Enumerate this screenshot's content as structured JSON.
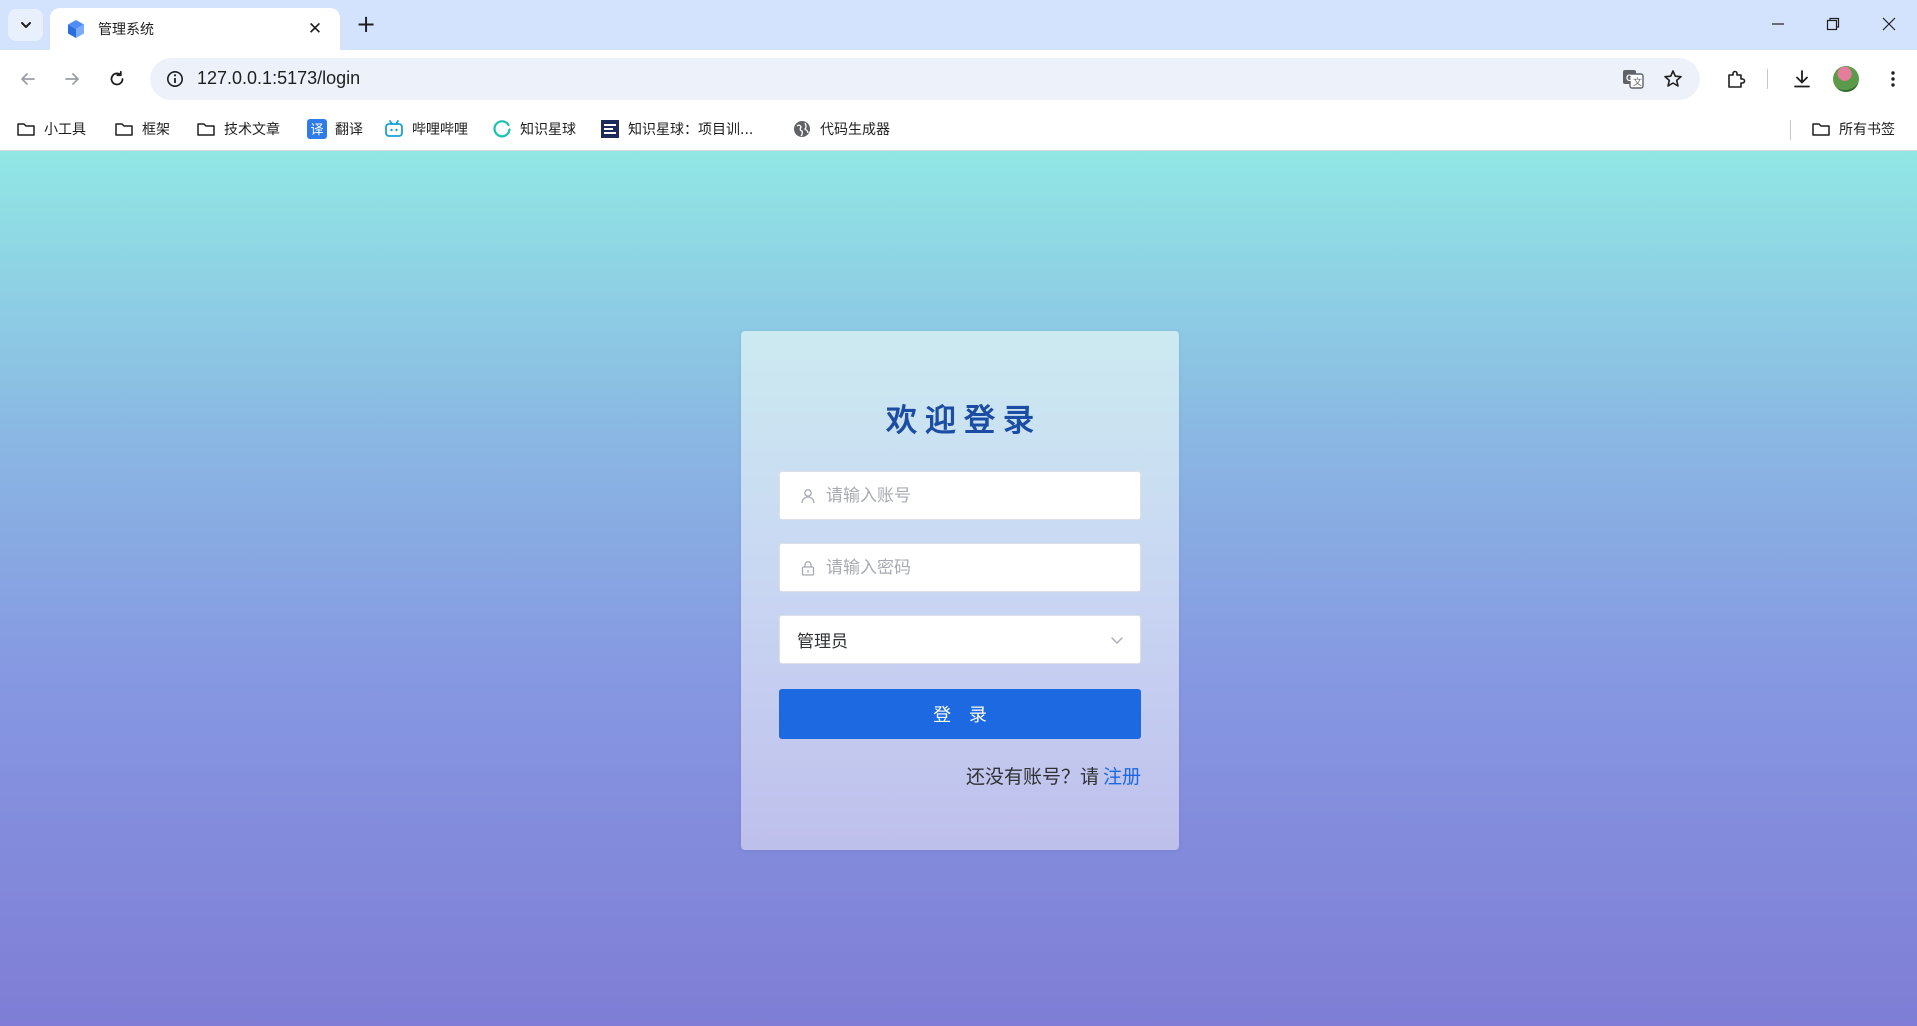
{
  "browser": {
    "tab": {
      "title": "管理系统"
    },
    "new_tab_label": "+",
    "url": "127.0.0.1:5173/login",
    "bookmarks": [
      {
        "label": "小工具",
        "icon": "folder-icon"
      },
      {
        "label": "框架",
        "icon": "folder-icon"
      },
      {
        "label": "技术文章",
        "icon": "folder-icon"
      },
      {
        "label": "翻译",
        "icon": "translate-icon"
      },
      {
        "label": "哔哩哔哩",
        "icon": "bilibili-icon"
      },
      {
        "label": "知识星球",
        "icon": "zsxq-icon"
      },
      {
        "label": "知识星球：项目训...",
        "icon": "zsxq-project-icon"
      },
      {
        "label": "代码生成器",
        "icon": "globe-icon"
      }
    ],
    "all_bookmarks": "所有书签"
  },
  "login": {
    "title": "欢迎登录",
    "username_placeholder": "请输入账号",
    "password_placeholder": "请输入密码",
    "role_selected": "管理员",
    "submit_label": "登 录",
    "register_prompt": "还没有账号？请",
    "register_link": "注册"
  },
  "colors": {
    "title": "#1c4da4",
    "primary": "#1d69e1",
    "gradient_top": "#91e7e4",
    "gradient_bottom": "#7f7dd5"
  }
}
